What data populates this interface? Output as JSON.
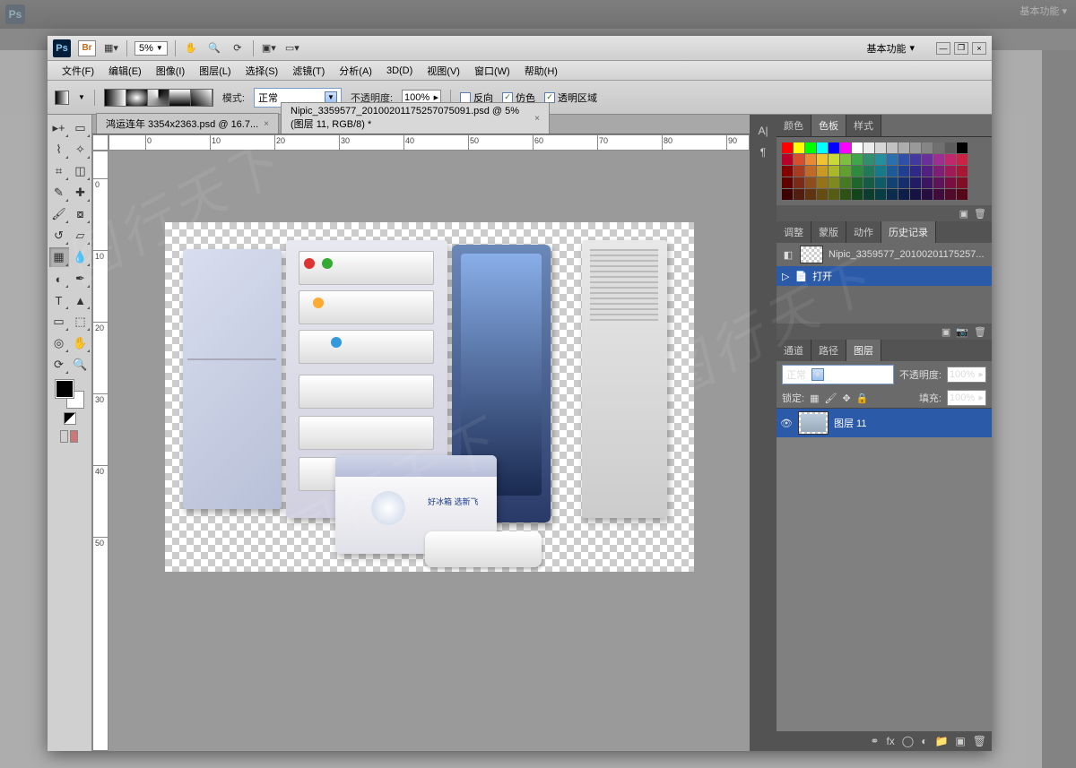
{
  "outer": {
    "workspace_label": "基本功能 ▾",
    "zoom": "5%"
  },
  "titlebar": {
    "ps": "Ps",
    "br": "Br",
    "zoom": "5%",
    "workspace": "基本功能",
    "minimize": "—",
    "restore": "❐",
    "close": "×"
  },
  "menu": [
    "文件(F)",
    "编辑(E)",
    "图像(I)",
    "图层(L)",
    "选择(S)",
    "滤镜(T)",
    "分析(A)",
    "3D(D)",
    "视图(V)",
    "窗口(W)",
    "帮助(H)"
  ],
  "options": {
    "mode_label": "模式:",
    "mode_value": "正常",
    "opacity_label": "不透明度:",
    "opacity_value": "100%",
    "reverse": "反向",
    "dither": "仿色",
    "transparency": "透明区域",
    "reverse_checked": false,
    "dither_checked": true,
    "transparency_checked": true
  },
  "docs": {
    "tab1": "鸿运连年 3354x2363.psd @ 16.7...",
    "tab2": "Nipic_3359577_20100201175257075091.psd @ 5% (图层 11, RGB/8) *"
  },
  "ruler_marks_h": [
    0,
    10,
    20,
    30,
    40,
    50,
    60,
    70,
    80,
    90
  ],
  "ruler_marks_v": [
    0,
    10,
    20,
    30,
    40,
    50
  ],
  "sidecol": [
    "A|",
    "¶"
  ],
  "panels": {
    "color_tabs": [
      "颜色",
      "色板",
      "样式"
    ],
    "adjust_tabs": [
      "调整",
      "蒙版",
      "动作",
      "历史记录"
    ],
    "history_doc": "Nipic_3359577_20100201175257...",
    "history_step": "打开",
    "layer_tabs": [
      "通道",
      "路径",
      "图层"
    ],
    "blend_mode": "正常",
    "opacity_label": "不透明度:",
    "opacity_val": "100%",
    "lock_label": "锁定:",
    "fill_label": "填充:",
    "fill_val": "100%",
    "layer_name": "图层 11"
  },
  "swatch_colors": [
    "#ff0000",
    "#ffff00",
    "#00ff00",
    "#00ffff",
    "#0000ff",
    "#ff00ff",
    "#ffffff",
    "#ebebeb",
    "#d6d6d6",
    "#c2c2c2",
    "#adadad",
    "#999999",
    "#858585",
    "#707070",
    "#5c5c5c",
    "#000000",
    "#b8002b",
    "#d94f2e",
    "#e88b38",
    "#f0c330",
    "#c8d938",
    "#7fbf3f",
    "#3fa64b",
    "#2f8f6f",
    "#258f9e",
    "#2a6fb0",
    "#3050a8",
    "#4338a0",
    "#6a3099",
    "#9e2e92",
    "#c0286e",
    "#cc2244",
    "#820000",
    "#a83a1f",
    "#bf6a28",
    "#c99a22",
    "#a8b82a",
    "#5fa030",
    "#2e8a3c",
    "#1f7a5a",
    "#177a88",
    "#1c5a98",
    "#203f90",
    "#302888",
    "#52207f",
    "#7e1e78",
    "#a01a58",
    "#aa1533",
    "#5e0000",
    "#7a2a16",
    "#8c4e1c",
    "#967218",
    "#7e8a1e",
    "#457a22",
    "#1f662c",
    "#145c44",
    "#0f5c66",
    "#124272",
    "#162e6c",
    "#221c66",
    "#3c1660",
    "#5e145a",
    "#780f40",
    "#800e25",
    "#3d0000",
    "#521c0e",
    "#5e3412",
    "#654c10",
    "#555c14",
    "#2e5216",
    "#14441c",
    "#0c3d2e",
    "#093d44",
    "#0b2c4c",
    "#0e1e48",
    "#161244",
    "#280e40",
    "#3f0c3c",
    "#500a2a",
    "#560818"
  ],
  "chest_text": "好冰箱\n选新飞"
}
